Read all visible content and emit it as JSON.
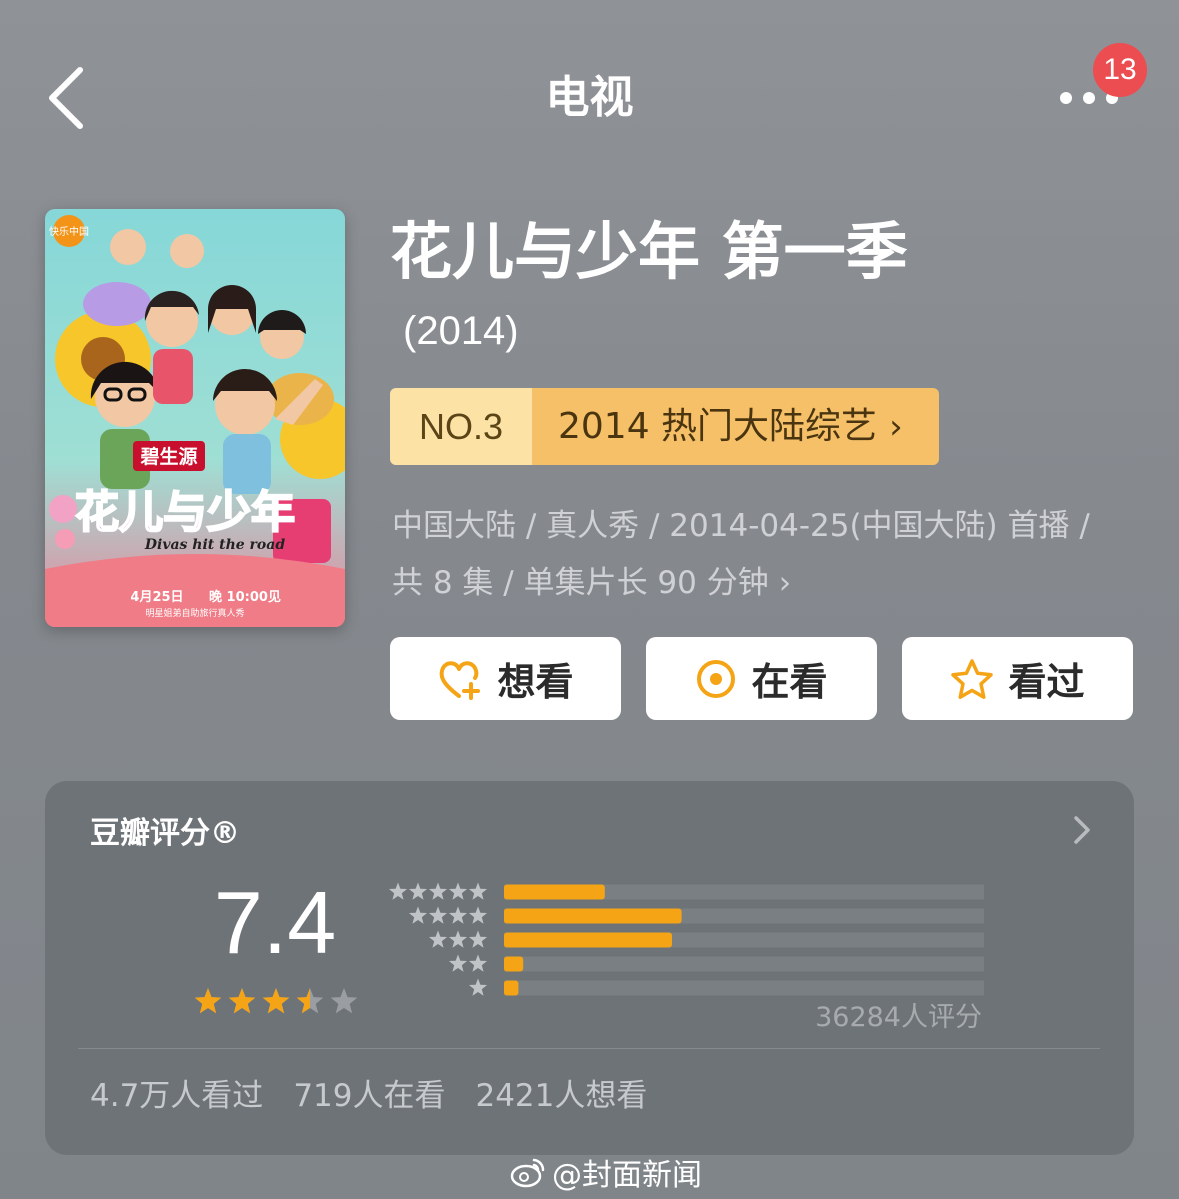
{
  "header": {
    "title": "电视",
    "notification_count": "13",
    "back_icon": "chevron-left-icon",
    "more_icon": "more-dots-icon"
  },
  "show": {
    "name": "花儿与少年 第一季",
    "year": "(2014)",
    "rank": {
      "number": "NO.3",
      "category": "2014 热门大陆综艺"
    },
    "meta_line1": "中国大陆 / 真人秀 / 2014-04-25(中国大陆) 首播 /",
    "meta_line2": "共 8 集 / 单集片长 90 分钟"
  },
  "poster": {
    "logo_text": "快乐中国",
    "brand_text": "碧生源",
    "title_art": "花儿与少年",
    "subtitle_en": "Divas hit the road",
    "airdate": "4月25日",
    "airtime": "晚 10:00见",
    "tagline": "明星姐弟自助旅行真人秀"
  },
  "actions": [
    {
      "label": "想看",
      "icon": "heart-plus-icon"
    },
    {
      "label": "在看",
      "icon": "target-circle-icon"
    },
    {
      "label": "看过",
      "icon": "star-outline-icon"
    }
  ],
  "rating": {
    "label": "豆瓣评分®",
    "score": "7.4",
    "stars_value": 3.5,
    "distribution": [
      {
        "stars": 5,
        "fraction": 0.21
      },
      {
        "stars": 4,
        "fraction": 0.37
      },
      {
        "stars": 3,
        "fraction": 0.35
      },
      {
        "stars": 2,
        "fraction": 0.04
      },
      {
        "stars": 1,
        "fraction": 0.03
      }
    ],
    "count_text": "36284人评分"
  },
  "stats": {
    "watched": "4.7万人看过",
    "watching": "719人在看",
    "want": "2421人想看"
  },
  "watermark": "@封面新闻",
  "colors": {
    "accent_orange": "#f5a416",
    "badge_red": "#ec4d50",
    "rank_light": "#fde2a6",
    "rank_dark": "#f5c068"
  }
}
